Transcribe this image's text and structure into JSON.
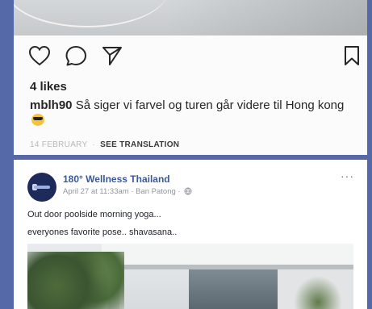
{
  "instagram_post": {
    "likes": "4 likes",
    "username": "mblh90",
    "caption": "Så siger vi farvel og turen går videre til Hong kong",
    "emoji": "sunglasses-emoji",
    "date": "14 FEBRUARY",
    "separator": "·",
    "see_translation": "SEE TRANSLATION",
    "icons": [
      "heart-icon",
      "comment-icon",
      "share-icon",
      "bookmark-icon"
    ]
  },
  "facebook_post": {
    "page_name": "180° Wellness Thailand",
    "time_location": "April 27 at 11:33am · Ban Patong ·",
    "more_label": "···",
    "text_line1": "Out door poolside morning yoga...",
    "text_line2": "everyones favorite pose.. shavasana..",
    "avatar_color": "#1d2a5a",
    "name_color": "#3b5998"
  },
  "background_color": "#5569a8"
}
